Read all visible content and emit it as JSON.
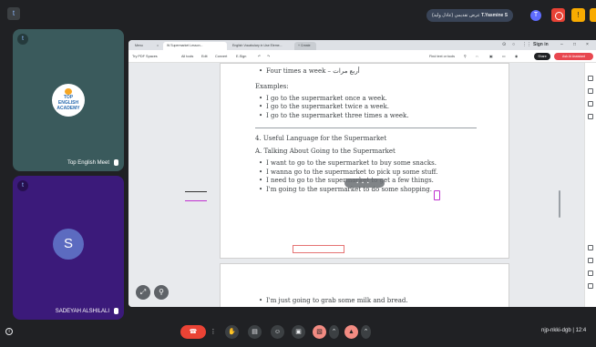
{
  "topbar": {
    "presenting_text": "(عادل وليد) عرض تقديمي",
    "presenter_name": "T.Yasmine S",
    "avatar_initial": "T",
    "app_initial": "t"
  },
  "participants": [
    {
      "name": "Top English Meet",
      "badge": "t",
      "logo_text": "TOP ENGLISH ACADEMY"
    },
    {
      "name": "SADEYAH ALSHILALI",
      "badge": "t",
      "initial": "S"
    }
  ],
  "browser": {
    "tabs": [
      "Menu",
      "Home",
      "W Supermarket Lesson...",
      "English Vocabulary in Use Eleme...",
      "+ Create"
    ],
    "signin": "Sign in",
    "pdf_toolbar": [
      "Try PDF Spaces",
      "All tools",
      "Edit",
      "Convert",
      "E-Sign",
      "Find text or tools"
    ],
    "share_label": "Share",
    "ai_label": "Ask AI Assistant"
  },
  "document": {
    "line_top": "Four times a week – أربع مرات",
    "examples_heading": "Examples:",
    "examples": [
      "I go to the supermarket once a week.",
      "I go to the supermarket twice a week.",
      "I go to the supermarket three times a week."
    ],
    "section_heading": "4. Useful Language for the Supermarket",
    "subsection": "A. Talking About Going to the Supermarket",
    "sentences": [
      "I want to go to the supermarket to buy some snacks.",
      "I wanna go to the supermarket to pick up some stuff.",
      "I need to go to the supermarket to get a few things.",
      "I'm going to the supermarket to do some shopping."
    ],
    "page2_line": "I'm just going to grab some milk and bread."
  },
  "bottom": {
    "meeting_code": "njp-nkki-dgb  |  12:4"
  }
}
